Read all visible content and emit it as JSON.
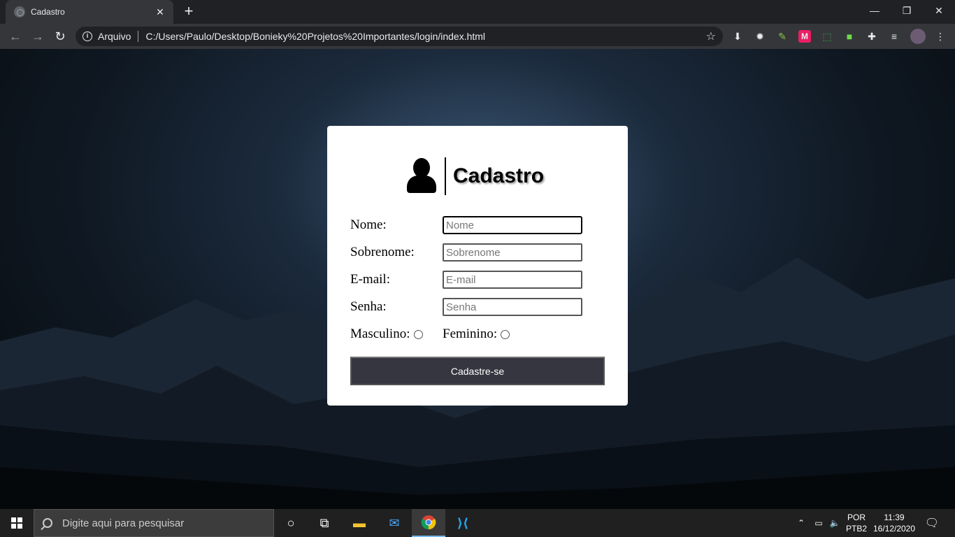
{
  "browser": {
    "tab_title": "Cadastro",
    "tab_close": "✕",
    "new_tab": "+",
    "minimize": "—",
    "restore": "❐",
    "close": "✕",
    "back": "←",
    "forward": "→",
    "reload": "↻",
    "site_info": "i",
    "security_label": "Arquivo",
    "url": "C:/Users/Paulo/Desktop/Bonieky%20Projetos%20Importantes/login/index.html",
    "bookmark_star": "☆"
  },
  "form": {
    "title": "Cadastro",
    "fields": [
      {
        "label": "Nome:",
        "placeholder": "Nome"
      },
      {
        "label": "Sobrenome:",
        "placeholder": "Sobrenome"
      },
      {
        "label": "E-mail:",
        "placeholder": "E-mail"
      },
      {
        "label": "Senha:",
        "placeholder": "Senha"
      }
    ],
    "radio_male": "Masculino:",
    "radio_female": "Feminino:",
    "submit_label": "Cadastre-se"
  },
  "taskbar": {
    "search_placeholder": "Digite aqui para pesquisar",
    "language_top": "POR",
    "language_bottom": "PTB2",
    "time": "11:39",
    "date": "16/12/2020"
  },
  "colors": {
    "accent": "#353640",
    "chrome_dark": "#202124",
    "chrome_toolbar": "#35363a",
    "taskbar": "#202020"
  }
}
